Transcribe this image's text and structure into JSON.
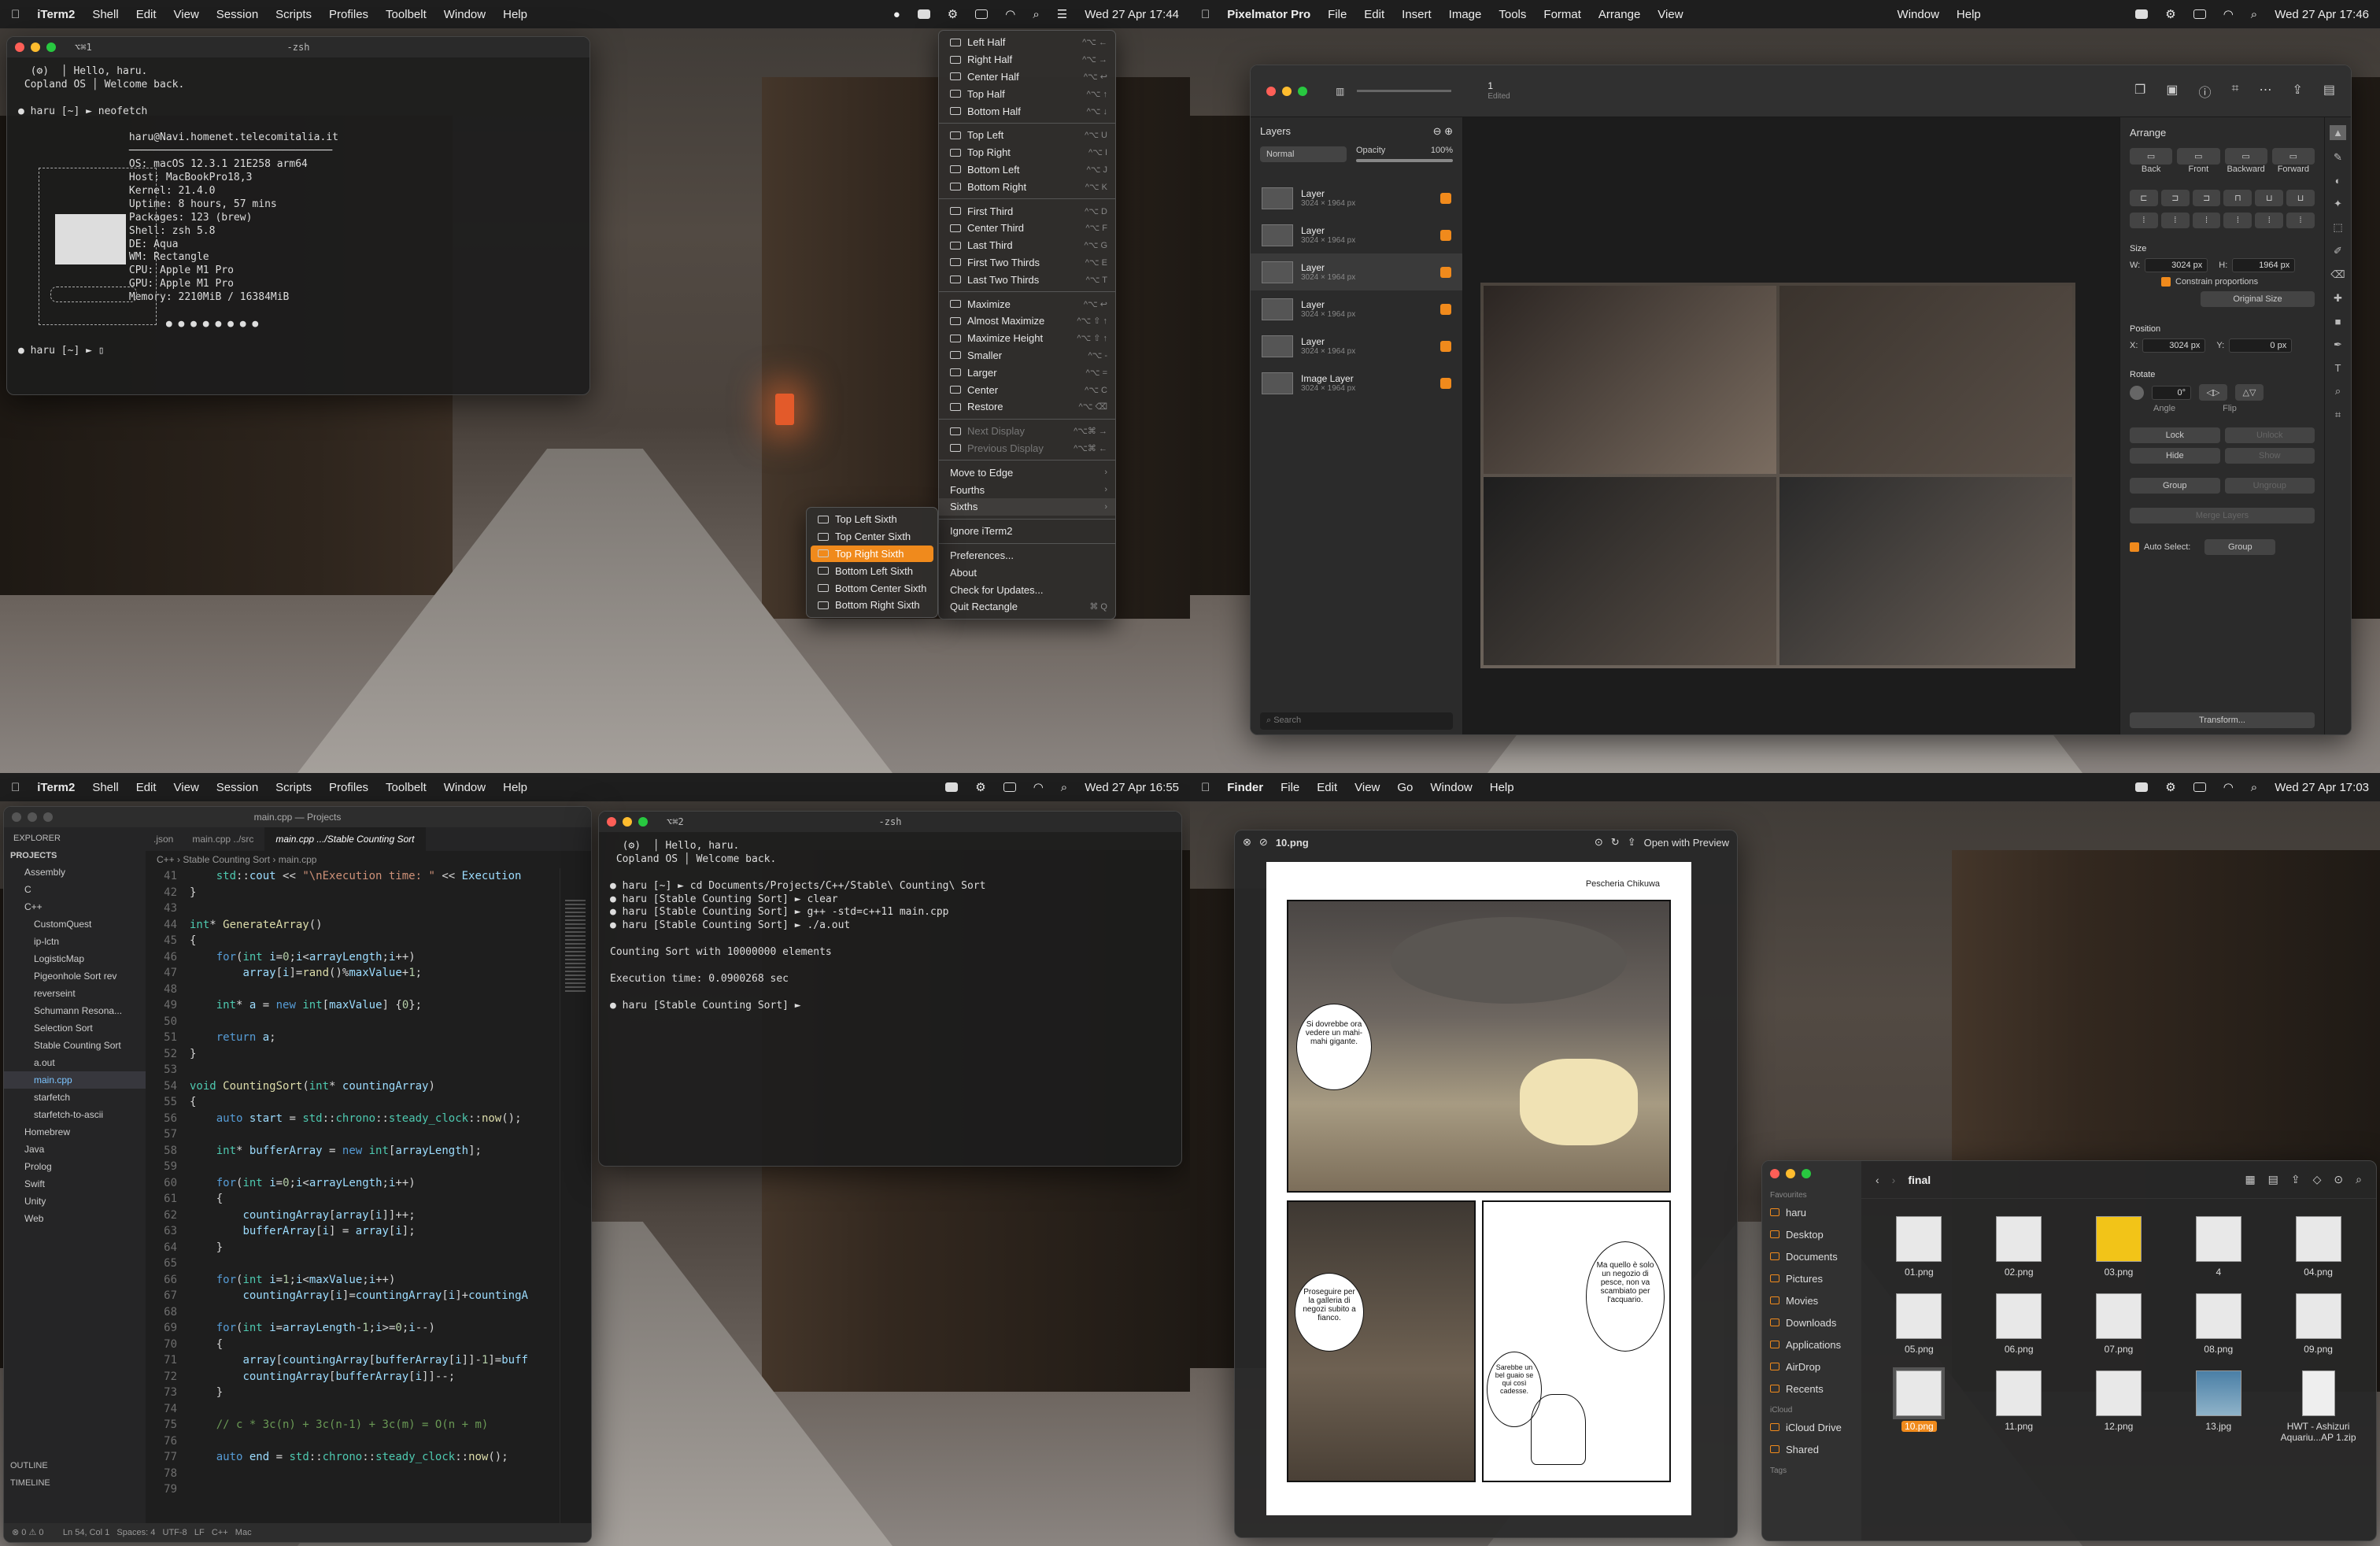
{
  "q1": {
    "menubar": {
      "app": "iTerm2",
      "items": [
        "Shell",
        "Edit",
        "View",
        "Session",
        "Scripts",
        "Profiles",
        "Toolbelt",
        "Window",
        "Help"
      ],
      "datetime": "Wed 27 Apr 17:44"
    },
    "terminal": {
      "tab": "⌥⌘1",
      "title": "-zsh",
      "content": "  (⚙)  │ Hello, haru.\n Copland OS │ Welcome back.\n\n● haru [~] ► neofetch\n\n                  haru@Navi.homenet.telecomitalia.it\n                  ─────────────────────────────────\n                  OS: macOS 12.3.1 21E258 arm64\n                  Host: MacBookPro18,3\n                  Kernel: 21.4.0\n                  Uptime: 8 hours, 57 mins\n                  Packages: 123 (brew)\n                  Shell: zsh 5.8\n                  DE: Aqua\n                  WM: Rectangle\n                  CPU: Apple M1 Pro\n                  GPU: Apple M1 Pro\n                  Memory: 2210MiB / 16384MiB\n\n                        ● ● ● ● ● ● ● ●\n\n● haru [~] ► ▯"
    },
    "rect_menu": [
      {
        "label": "Left Half",
        "sc": "^⌥ ←"
      },
      {
        "label": "Right Half",
        "sc": "^⌥ →"
      },
      {
        "label": "Center Half",
        "sc": "^⌥ ↩"
      },
      {
        "label": "Top Half",
        "sc": "^⌥ ↑"
      },
      {
        "label": "Bottom Half",
        "sc": "^⌥ ↓"
      },
      {
        "sep": true
      },
      {
        "label": "Top Left",
        "sc": "^⌥ U"
      },
      {
        "label": "Top Right",
        "sc": "^⌥ I"
      },
      {
        "label": "Bottom Left",
        "sc": "^⌥ J"
      },
      {
        "label": "Bottom Right",
        "sc": "^⌥ K"
      },
      {
        "sep": true
      },
      {
        "label": "First Third",
        "sc": "^⌥ D"
      },
      {
        "label": "Center Third",
        "sc": "^⌥ F"
      },
      {
        "label": "Last Third",
        "sc": "^⌥ G"
      },
      {
        "label": "First Two Thirds",
        "sc": "^⌥ E"
      },
      {
        "label": "Last Two Thirds",
        "sc": "^⌥ T"
      },
      {
        "sep": true
      },
      {
        "label": "Maximize",
        "sc": "^⌥ ↩"
      },
      {
        "label": "Almost Maximize",
        "sc": "^⌥ ⇧ ↑"
      },
      {
        "label": "Maximize Height",
        "sc": "^⌥ ⇧ ↑"
      },
      {
        "label": "Smaller",
        "sc": "^⌥ -"
      },
      {
        "label": "Larger",
        "sc": "^⌥ ="
      },
      {
        "label": "Center",
        "sc": "^⌥ C"
      },
      {
        "label": "Restore",
        "sc": "^⌥ ⌫"
      },
      {
        "sep": true
      },
      {
        "label": "Next Display",
        "sc": "^⌥⌘ →",
        "dis": true
      },
      {
        "label": "Previous Display",
        "sc": "^⌥⌘ ←",
        "dis": true
      },
      {
        "sep": true
      },
      {
        "label": "Move to Edge",
        "sc": "›",
        "noicon": true
      },
      {
        "label": "Fourths",
        "sc": "›",
        "noicon": true
      },
      {
        "label": "Sixths",
        "sc": "›",
        "noicon": true,
        "hover": true
      },
      {
        "sep": true
      },
      {
        "label": "Ignore iTerm2",
        "noicon": true
      },
      {
        "sep": true
      },
      {
        "label": "Preferences...",
        "noicon": true
      },
      {
        "label": "About",
        "noicon": true
      },
      {
        "label": "Check for Updates...",
        "noicon": true
      },
      {
        "label": "Quit Rectangle",
        "sc": "⌘ Q",
        "noicon": true
      }
    ],
    "sixths": [
      "Top Left Sixth",
      "Top Center Sixth",
      "Top Right Sixth",
      "Bottom Left Sixth",
      "Bottom Center Sixth",
      "Bottom Right Sixth"
    ],
    "sixths_selected": 2
  },
  "q2": {
    "menubar": {
      "app": "Pixelmator Pro",
      "items": [
        "File",
        "Edit",
        "Insert",
        "Image",
        "Tools",
        "Format",
        "Arrange",
        "View"
      ],
      "extra": [
        "Window",
        "Help"
      ],
      "datetime": "Wed 27 Apr 17:46"
    },
    "doc_title": "1",
    "doc_sub": "Edited",
    "layers_title": "Layers",
    "blend": "Normal",
    "opacity_label": "Opacity",
    "opacity_value": "100%",
    "layers": [
      {
        "name": "Layer",
        "size": "3024 × 1964 px"
      },
      {
        "name": "Layer",
        "size": "3024 × 1964 px"
      },
      {
        "name": "Layer",
        "size": "3024 × 1964 px"
      },
      {
        "name": "Layer",
        "size": "3024 × 1964 px"
      },
      {
        "name": "Layer",
        "size": "3024 × 1964 px"
      },
      {
        "name": "Image Layer",
        "size": "3024 × 1964 px"
      }
    ],
    "search_placeholder": "Search",
    "arrange": {
      "title": "Arrange",
      "order": [
        "Back",
        "Front",
        "Backward",
        "Forward"
      ],
      "size_title": "Size",
      "w_label": "W:",
      "w": "3024 px",
      "h_label": "H:",
      "h": "1964 px",
      "constrain": "Constrain proportions",
      "original": "Original Size",
      "pos_title": "Position",
      "x_label": "X:",
      "x": "3024 px",
      "y_label": "Y:",
      "y": "0 px",
      "rot_title": "Rotate",
      "angle": "0°",
      "angle_label": "Angle",
      "flip_label": "Flip",
      "lock": "Lock",
      "unlock": "Unlock",
      "hide": "Hide",
      "show": "Show",
      "group": "Group",
      "ungroup": "Ungroup",
      "merge": "Merge Layers",
      "autoselect": "Auto Select:",
      "autoselect_val": "Group",
      "transform": "Transform..."
    }
  },
  "q3": {
    "menubar": {
      "app": "iTerm2",
      "items": [
        "Shell",
        "Edit",
        "View",
        "Session",
        "Scripts",
        "Profiles",
        "Toolbelt",
        "Window",
        "Help"
      ],
      "datetime": "Wed 27 Apr 16:55"
    },
    "vscode": {
      "title": "main.cpp — Projects",
      "explorer": "EXPLORER",
      "projects": "PROJECTS",
      "tree": [
        "Assembly",
        "C",
        "C++",
        "CustomQuest",
        "ip-lctn",
        "LogisticMap",
        "Pigeonhole Sort rev",
        "reverseint",
        "Schumann Resona...",
        "Selection Sort",
        "Stable Counting Sort",
        "a.out",
        "main.cpp",
        "starfetch",
        "starfetch-to-ascii",
        "Homebrew",
        "Java",
        "Prolog",
        "Swift",
        "Unity",
        "Web"
      ],
      "outline": "OUTLINE",
      "timeline": "TIMELINE",
      "tabs": [
        ".json",
        "main.cpp ../src",
        "main.cpp .../Stable Counting Sort"
      ],
      "breadcrumb": "C++ › Stable Counting Sort › main.cpp",
      "lines": [
        "41",
        "42",
        "43",
        "44",
        "45",
        "46",
        "47",
        "48",
        "49",
        "50",
        "51",
        "52",
        "53",
        "54",
        "55",
        "56",
        "57",
        "58",
        "59",
        "60",
        "61",
        "62",
        "63",
        "64",
        "65",
        "66",
        "67",
        "68",
        "69",
        "70",
        "71",
        "72",
        "73",
        "74",
        "75",
        "76",
        "77",
        "78",
        "79"
      ],
      "status": "⊗ 0 ⚠ 0        Ln 54, Col 1   Spaces: 4   UTF-8   LF   C++   Mac"
    },
    "terminal": {
      "tab": "⌥⌘2",
      "title": "-zsh",
      "content": "  (⚙)  │ Hello, haru.\n Copland OS │ Welcome back.\n\n● haru [~] ► cd Documents/Projects/C++/Stable\\ Counting\\ Sort\n● haru [Stable Counting Sort] ► clear\n● haru [Stable Counting Sort] ► g++ -std=c++11 main.cpp\n● haru [Stable Counting Sort] ► ./a.out\n\nCounting Sort with 10000000 elements\n\nExecution time: 0.0900268 sec\n\n● haru [Stable Counting Sort] ►"
    }
  },
  "q4": {
    "menubar": {
      "app": "Finder",
      "items": [
        "File",
        "Edit",
        "View",
        "Go",
        "Window",
        "Help"
      ],
      "datetime": "Wed 27 Apr 17:03"
    },
    "preview": {
      "file": "10.png",
      "open_with": "Open with Preview",
      "manga": {
        "shop": "Pescheria Chikuwa",
        "b1": "Si dovrebbe ora vedere un mahi-mahi gigante.",
        "b2": "Proseguire per la galleria di negozi subito a fianco.",
        "b3": "Ma quello è solo un negozio di pesce, non va scambiato per l'acquario.",
        "b4": "Sarebbe un bel guaio se qui così cadesse."
      }
    },
    "finder": {
      "folder": "final",
      "favourites": "Favourites",
      "sidebar": [
        "haru",
        "Desktop",
        "Documents",
        "Pictures",
        "Movies",
        "Downloads",
        "Applications",
        "AirDrop",
        "Recents"
      ],
      "icloud": "iCloud",
      "icloud_items": [
        "iCloud Drive",
        "Shared"
      ],
      "tags": "Tags",
      "files": [
        "01.png",
        "02.png",
        "03.png",
        "4",
        "04.png",
        "05.png",
        "06.png",
        "07.png",
        "08.png",
        "09.png",
        "10.png",
        "11.png",
        "12.png",
        "13.jpg",
        "HWT - Ashizuri Aquariu...AP 1.zip"
      ],
      "selected": 10
    }
  }
}
